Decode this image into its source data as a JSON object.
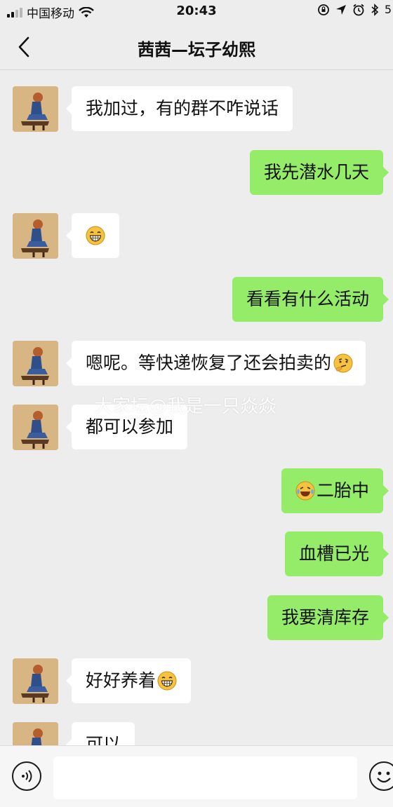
{
  "status_bar": {
    "carrier": "中国移动",
    "time": "20:43",
    "battery_text": "5"
  },
  "nav": {
    "title": "茜茜—坛子幼熙"
  },
  "watermark": "大家坛@我是一只焱焱",
  "messages": [
    {
      "side": "in",
      "text": "我加过，有的群不咋说话",
      "emoji": null
    },
    {
      "side": "out",
      "text": "我先潜水几天",
      "emoji": null
    },
    {
      "side": "in",
      "text": "",
      "emoji": "grin-emoji"
    },
    {
      "side": "out",
      "text": "看看有什么活动",
      "emoji": null
    },
    {
      "side": "in",
      "text": "嗯呢。等快递恢复了还会拍卖的",
      "emoji": "thinking-emoji"
    },
    {
      "side": "in",
      "text": "都可以参加",
      "emoji": null
    },
    {
      "side": "out",
      "text": "二胎中",
      "emoji": "laugh-cry-emoji"
    },
    {
      "side": "out",
      "text": "血槽已光",
      "emoji": null
    },
    {
      "side": "out",
      "text": "我要清库存",
      "emoji": null
    },
    {
      "side": "in",
      "text": "好好养着",
      "emoji": "grin-emoji"
    },
    {
      "side": "in",
      "text": "可以",
      "emoji": null
    }
  ],
  "input": {
    "placeholder": ""
  },
  "colors": {
    "background": "#ededed",
    "outgoing_bubble": "#95ec69",
    "incoming_bubble": "#ffffff"
  }
}
